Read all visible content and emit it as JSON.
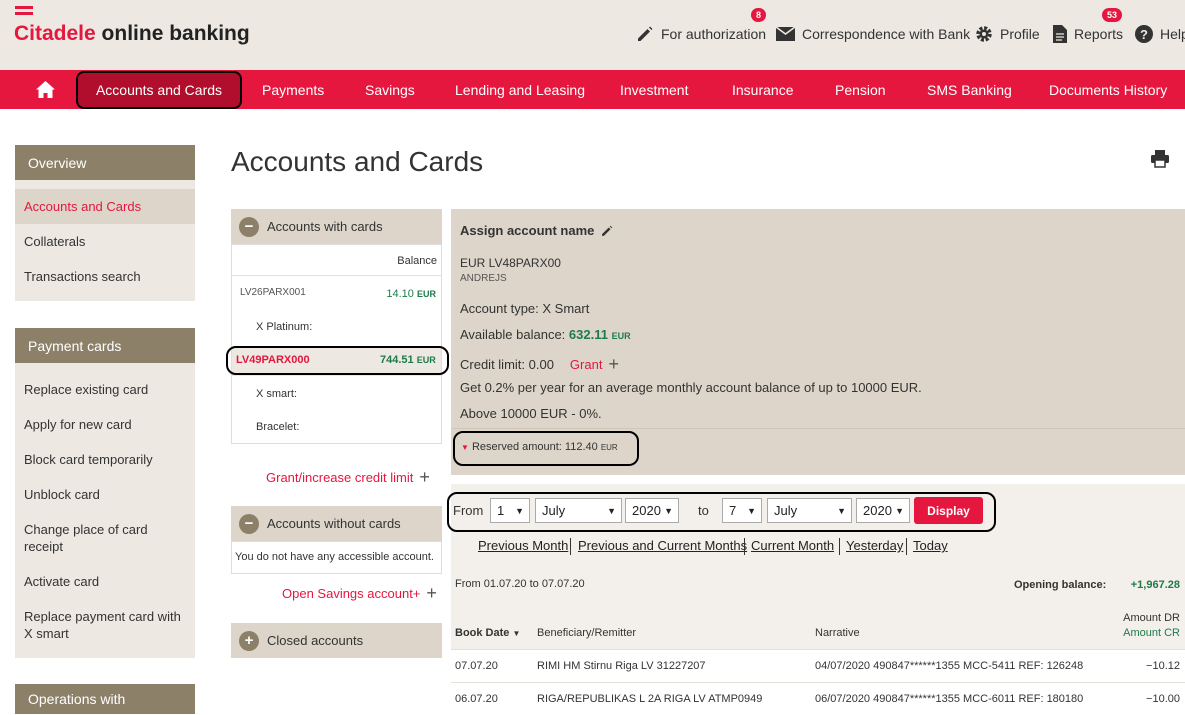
{
  "header": {
    "brand": "Citadele",
    "brand_rest": " online banking",
    "links": {
      "authorization": {
        "label": "For authorization",
        "badge": "8"
      },
      "correspondence": {
        "label": "Correspondence with Bank"
      },
      "profile": {
        "label": "Profile"
      },
      "reports": {
        "label": "Reports",
        "badge": "53"
      },
      "help": {
        "label": "Help"
      }
    }
  },
  "nav": {
    "home_icon": "home-icon",
    "items": [
      "Accounts and Cards",
      "Payments",
      "Savings",
      "Lending and Leasing",
      "Investment",
      "Insurance",
      "Pension",
      "SMS Banking",
      "Documents History"
    ]
  },
  "sidebar": {
    "overview": {
      "title": "Overview",
      "items": [
        "Accounts and Cards",
        "Collaterals",
        "Transactions search"
      ]
    },
    "payment_cards": {
      "title": "Payment cards",
      "items": [
        "Replace existing card",
        "Apply for new card",
        "Block card temporarily",
        "Unblock card",
        "Change place of card receipt",
        "Activate card",
        "Replace payment card with X smart"
      ]
    },
    "operations": {
      "title": "Operations with"
    }
  },
  "page": {
    "title": "Accounts and Cards"
  },
  "accounts_with_cards": {
    "title": "Accounts with cards",
    "balance_header": "Balance",
    "accounts": [
      {
        "number": "LV26PARX001",
        "balance": "14.10",
        "currency": "EUR",
        "card": "X Platinum:"
      },
      {
        "number": "LV49PARX000",
        "balance": "744.51",
        "currency": "EUR",
        "cards": [
          "X smart:",
          "Bracelet:"
        ]
      }
    ],
    "credit_link": "Grant/increase credit limit"
  },
  "accounts_without_cards": {
    "title": "Accounts without cards",
    "empty": "You do not have any accessible account.",
    "savings_link": "Open Savings account+"
  },
  "closed_accounts": {
    "title": "Closed accounts"
  },
  "detail": {
    "assign_name": "Assign account name",
    "account_line": "EUR LV48PARX00",
    "holder": "ANDREJS",
    "account_type": "Account type: X Smart",
    "available_label": "Available balance:",
    "available_value": "632.11",
    "currency": "EUR",
    "credit_limit": "Credit limit: 0.00",
    "grant": "Grant",
    "interest_1": "Get 0.2% per year for an average monthly account balance of up to 10000 EUR.",
    "interest_2": "Above 10000 EUR - 0%.",
    "reserved": "Reserved amount: 112.40",
    "reserved_currency": "EUR"
  },
  "filter": {
    "from_label": "From",
    "from_day": "1",
    "from_month": "July",
    "from_year": "2020",
    "to_label": "to",
    "to_day": "7",
    "to_month": "July",
    "to_year": "2020",
    "display": "Display",
    "quick_links": [
      "Previous Month",
      "Previous and Current Months",
      "Current Month",
      "Yesterday",
      "Today"
    ]
  },
  "statement": {
    "period": "From 01.07.20 to 07.07.20",
    "opening_label": "Opening balance:",
    "opening_value": "+1,967.28",
    "columns": {
      "date": "Book Date",
      "beneficiary": "Beneficiary/Remitter",
      "narrative": "Narrative",
      "amount_dr": "Amount DR",
      "amount_cr": "Amount CR"
    },
    "rows": [
      {
        "date": "07.07.20",
        "beneficiary": "RIMI HM Stirnu Riga LV 31227207",
        "narrative": "04/07/2020 490847******1355 MCC-5411 REF: 126248",
        "amount": "−10.12"
      },
      {
        "date": "06.07.20",
        "beneficiary": "RIGA/REPUBLIKAS L 2A RIGA LV ATMP0949",
        "narrative": "06/07/2020 490847******1355 MCC-6011 REF: 180180",
        "amount": "−10.00"
      }
    ]
  },
  "colors": {
    "brand_red": "#e5173f",
    "nav_active": "#b00e2c",
    "sidebar_head": "#8c8069",
    "beige": "#ede8e1",
    "green": "#1f7a4a"
  }
}
